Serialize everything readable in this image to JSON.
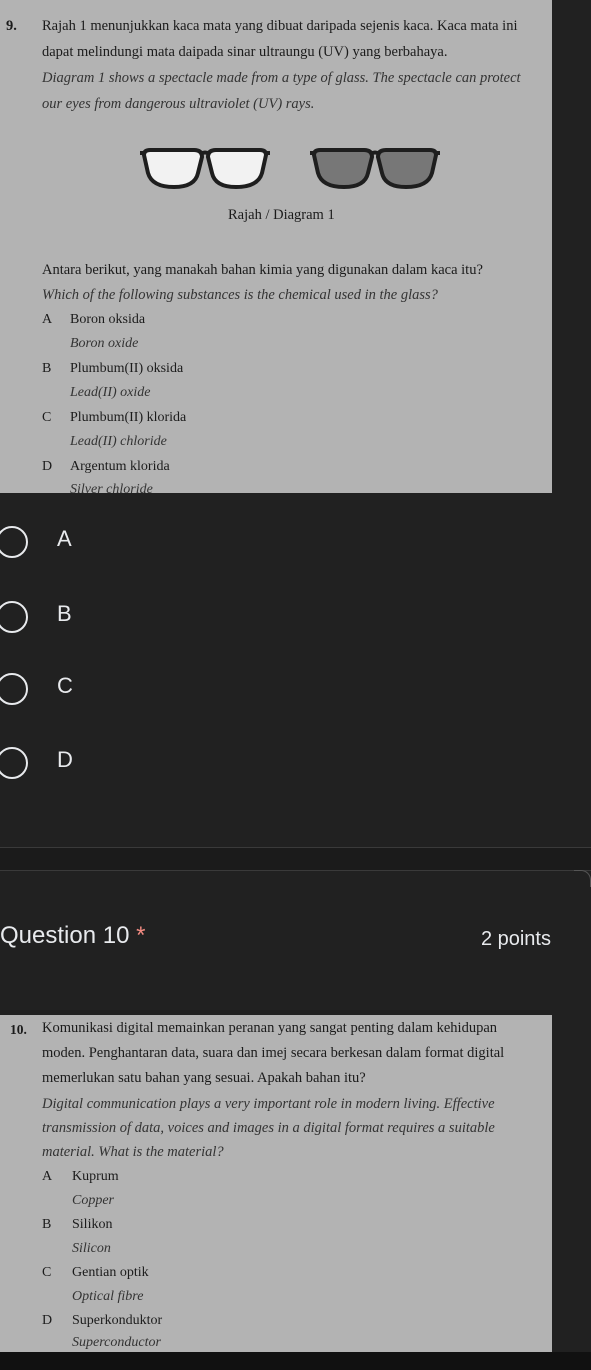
{
  "question9": {
    "lines": [
      {
        "num": "9.",
        "text": "Rajah 1 menunjukkan kaca mata yang dibuat daripada sejenis kaca. Kaca mata ini"
      },
      {
        "text": "dapat melindungi mata daipada sinar ultraungu (UV) yang berbahaya."
      },
      {
        "text": "Diagram 1 shows a spectacle made from a type of glass. The spectacle can protect"
      },
      {
        "text": "our eyes from dangerous ultraviolet (UV) rays."
      }
    ],
    "diagram_caption": "Rajah / Diagram 1",
    "stem_ms": "Antara berikut, yang manakah bahan kimia yang digunakan dalam kaca itu?",
    "stem_en": "Which of the following substances is the chemical used in the glass?",
    "options": [
      {
        "letter": "A",
        "ms": "Boron oksida",
        "en": "Boron oxide"
      },
      {
        "letter": "B",
        "ms": "Plumbum(II) oksida",
        "en": "Lead(II) oxide"
      },
      {
        "letter": "C",
        "ms": "Plumbum(II) klorida",
        "en": "Lead(II) chloride"
      },
      {
        "letter": "D",
        "ms": "Argentum klorida",
        "en": "Silver chloride"
      }
    ],
    "choices": [
      "A",
      "B",
      "C",
      "D"
    ]
  },
  "question10": {
    "title": "Question 10",
    "required_mark": "*",
    "points": "2 points",
    "lines": [
      "Komunikasi digital memainkan peranan yang sangat penting dalam kehidupan",
      "moden. Penghantaran data, suara dan imej secara berkesan dalam format digital",
      "memerlukan satu bahan yang sesuai. Apakah bahan itu?"
    ],
    "num": "10.",
    "lines_en": [
      "Digital communication plays a very important role in modern living. Effective",
      "transmission of data, voices and images in a digital format requires a suitable",
      "material. What is the material?"
    ],
    "options": [
      {
        "letter": "A",
        "ms": "Kuprum",
        "en": "Copper"
      },
      {
        "letter": "B",
        "ms": "Silikon",
        "en": "Silicon"
      },
      {
        "letter": "C",
        "ms": "Gentian optik",
        "en": "Optical fibre"
      },
      {
        "letter": "D",
        "ms": "Superkonduktor",
        "en": "Superconductor"
      }
    ]
  },
  "colors": {
    "background": "#212121",
    "image_bg": "#b3b3b3",
    "required": "#f28b82"
  }
}
